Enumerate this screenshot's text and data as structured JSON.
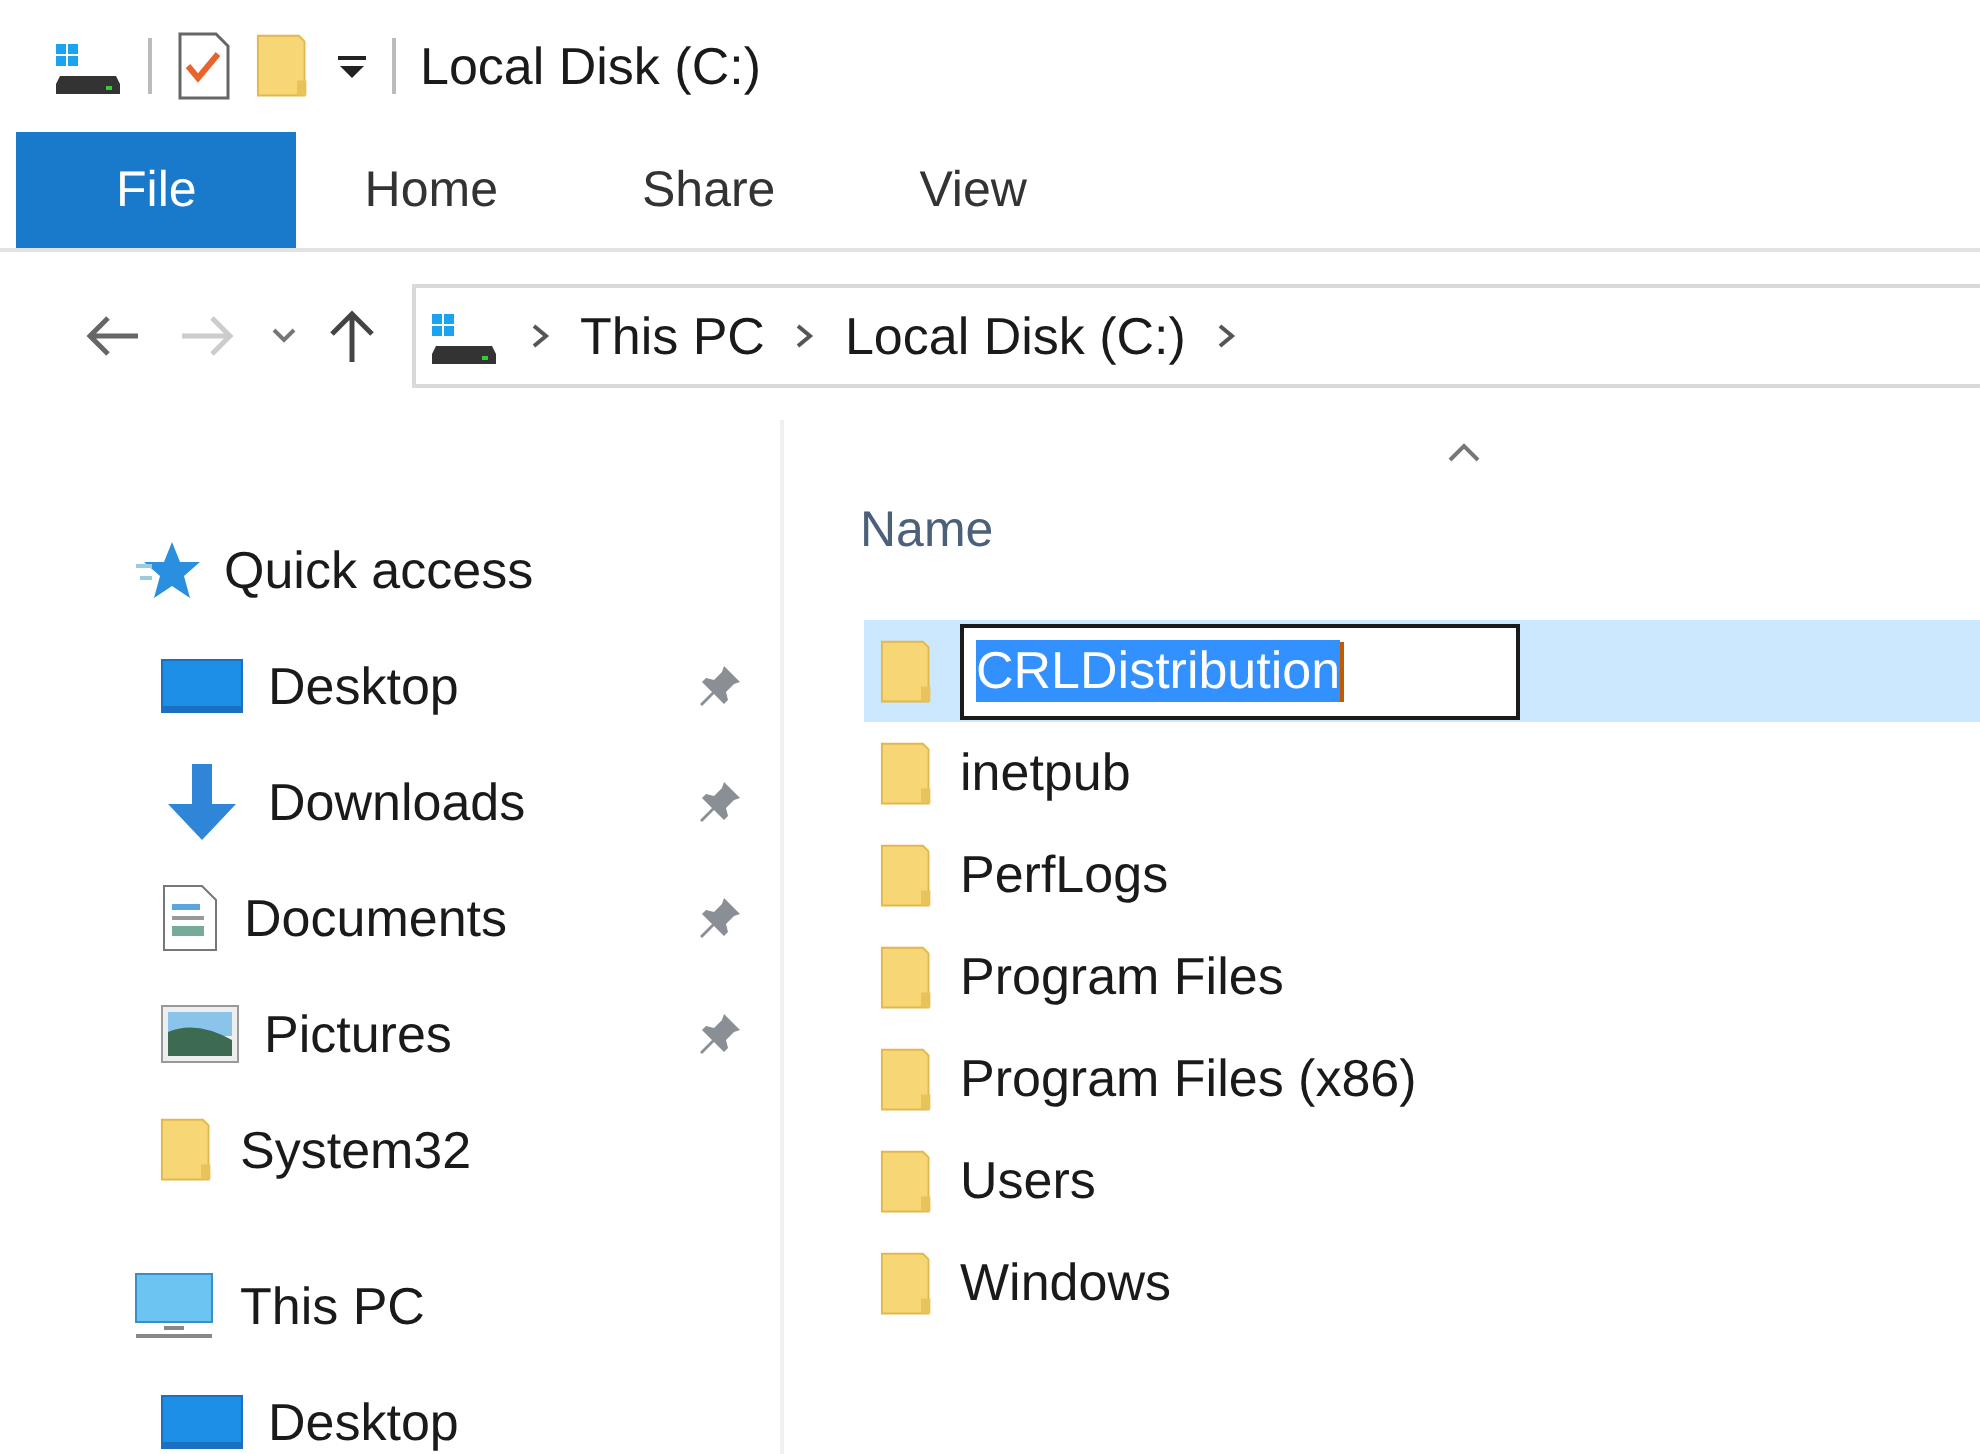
{
  "window": {
    "title": "Local Disk (C:)"
  },
  "ribbon_tabs": [
    {
      "label": "File",
      "kind": "file"
    },
    {
      "label": "Home",
      "kind": "tab"
    },
    {
      "label": "Share",
      "kind": "tab"
    },
    {
      "label": "View",
      "kind": "tab"
    }
  ],
  "navigation": {
    "back_disabled": false,
    "forward_disabled": true
  },
  "address_bar": {
    "crumbs": [
      "This PC",
      "Local Disk (C:)"
    ]
  },
  "navigation_pane": [
    {
      "label": "Quick access",
      "children": [
        {
          "label": "Desktop",
          "pinned": true
        },
        {
          "label": "Downloads",
          "pinned": true
        },
        {
          "label": "Documents",
          "pinned": true
        },
        {
          "label": "Pictures",
          "pinned": true
        },
        {
          "label": "System32",
          "pinned": false
        }
      ]
    },
    {
      "label": "This PC",
      "children": [
        {
          "label": "Desktop",
          "pinned": false
        }
      ]
    }
  ],
  "file_list": {
    "columns": [
      {
        "label": "Name",
        "sorted": true
      }
    ],
    "rows": [
      {
        "name": "CRLDistribution",
        "selected": true,
        "renaming": true
      },
      {
        "name": "inetpub",
        "selected": false,
        "renaming": false
      },
      {
        "name": "PerfLogs",
        "selected": false,
        "renaming": false
      },
      {
        "name": "Program Files",
        "selected": false,
        "renaming": false
      },
      {
        "name": "Program Files (x86)",
        "selected": false,
        "renaming": false
      },
      {
        "name": "Users",
        "selected": false,
        "renaming": false
      },
      {
        "name": "Windows",
        "selected": false,
        "renaming": false
      }
    ]
  }
}
